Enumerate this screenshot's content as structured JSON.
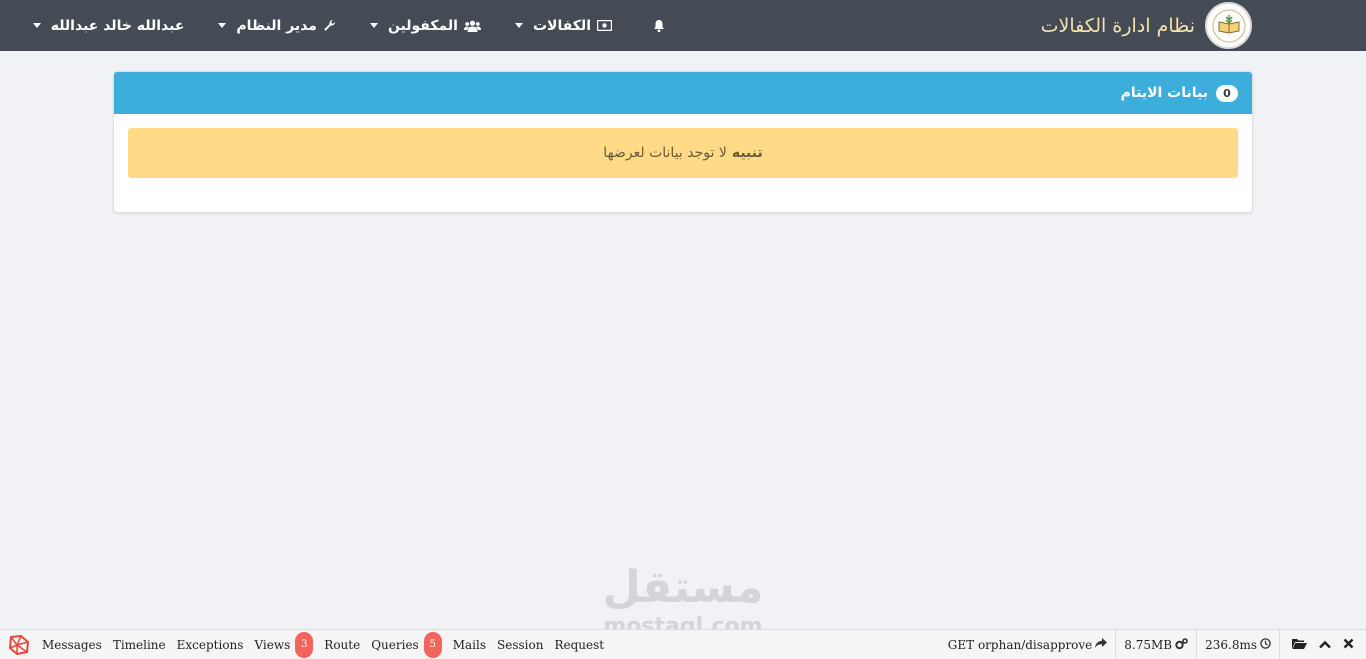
{
  "app": {
    "title": "نظام ادارة الكفالات"
  },
  "nav": {
    "items": [
      {
        "label": "الكفالات",
        "icon": "money-icon"
      },
      {
        "label": "المكفولين",
        "icon": "users-icon"
      },
      {
        "label": "مدير النظام",
        "icon": "wrench-icon"
      },
      {
        "label": "عبدالله خالد عبدالله",
        "icon": ""
      }
    ]
  },
  "card": {
    "title": "بيانات الايتام",
    "count": "0",
    "alert_strong": "تنبيه",
    "alert_text": "لا توجد بيانات لعرضها"
  },
  "watermark": {
    "arabic": "مستقل",
    "latin": "mostaql.com"
  },
  "debugbar": {
    "tabs": [
      {
        "label": "Messages"
      },
      {
        "label": "Timeline"
      },
      {
        "label": "Exceptions"
      },
      {
        "label": "Views",
        "badge": "3"
      },
      {
        "label": "Route"
      },
      {
        "label": "Queries",
        "badge": "5"
      },
      {
        "label": "Mails"
      },
      {
        "label": "Session"
      },
      {
        "label": "Request"
      }
    ],
    "route": "GET orphan/disapprove",
    "memory": "8.75MB",
    "time": "236.8ms"
  },
  "colors": {
    "navbar": "#444b55",
    "brand_text": "#f7e3a8",
    "card_header": "#3daedb",
    "alert_bg": "#ffdb88",
    "badge": "#f4645f"
  }
}
